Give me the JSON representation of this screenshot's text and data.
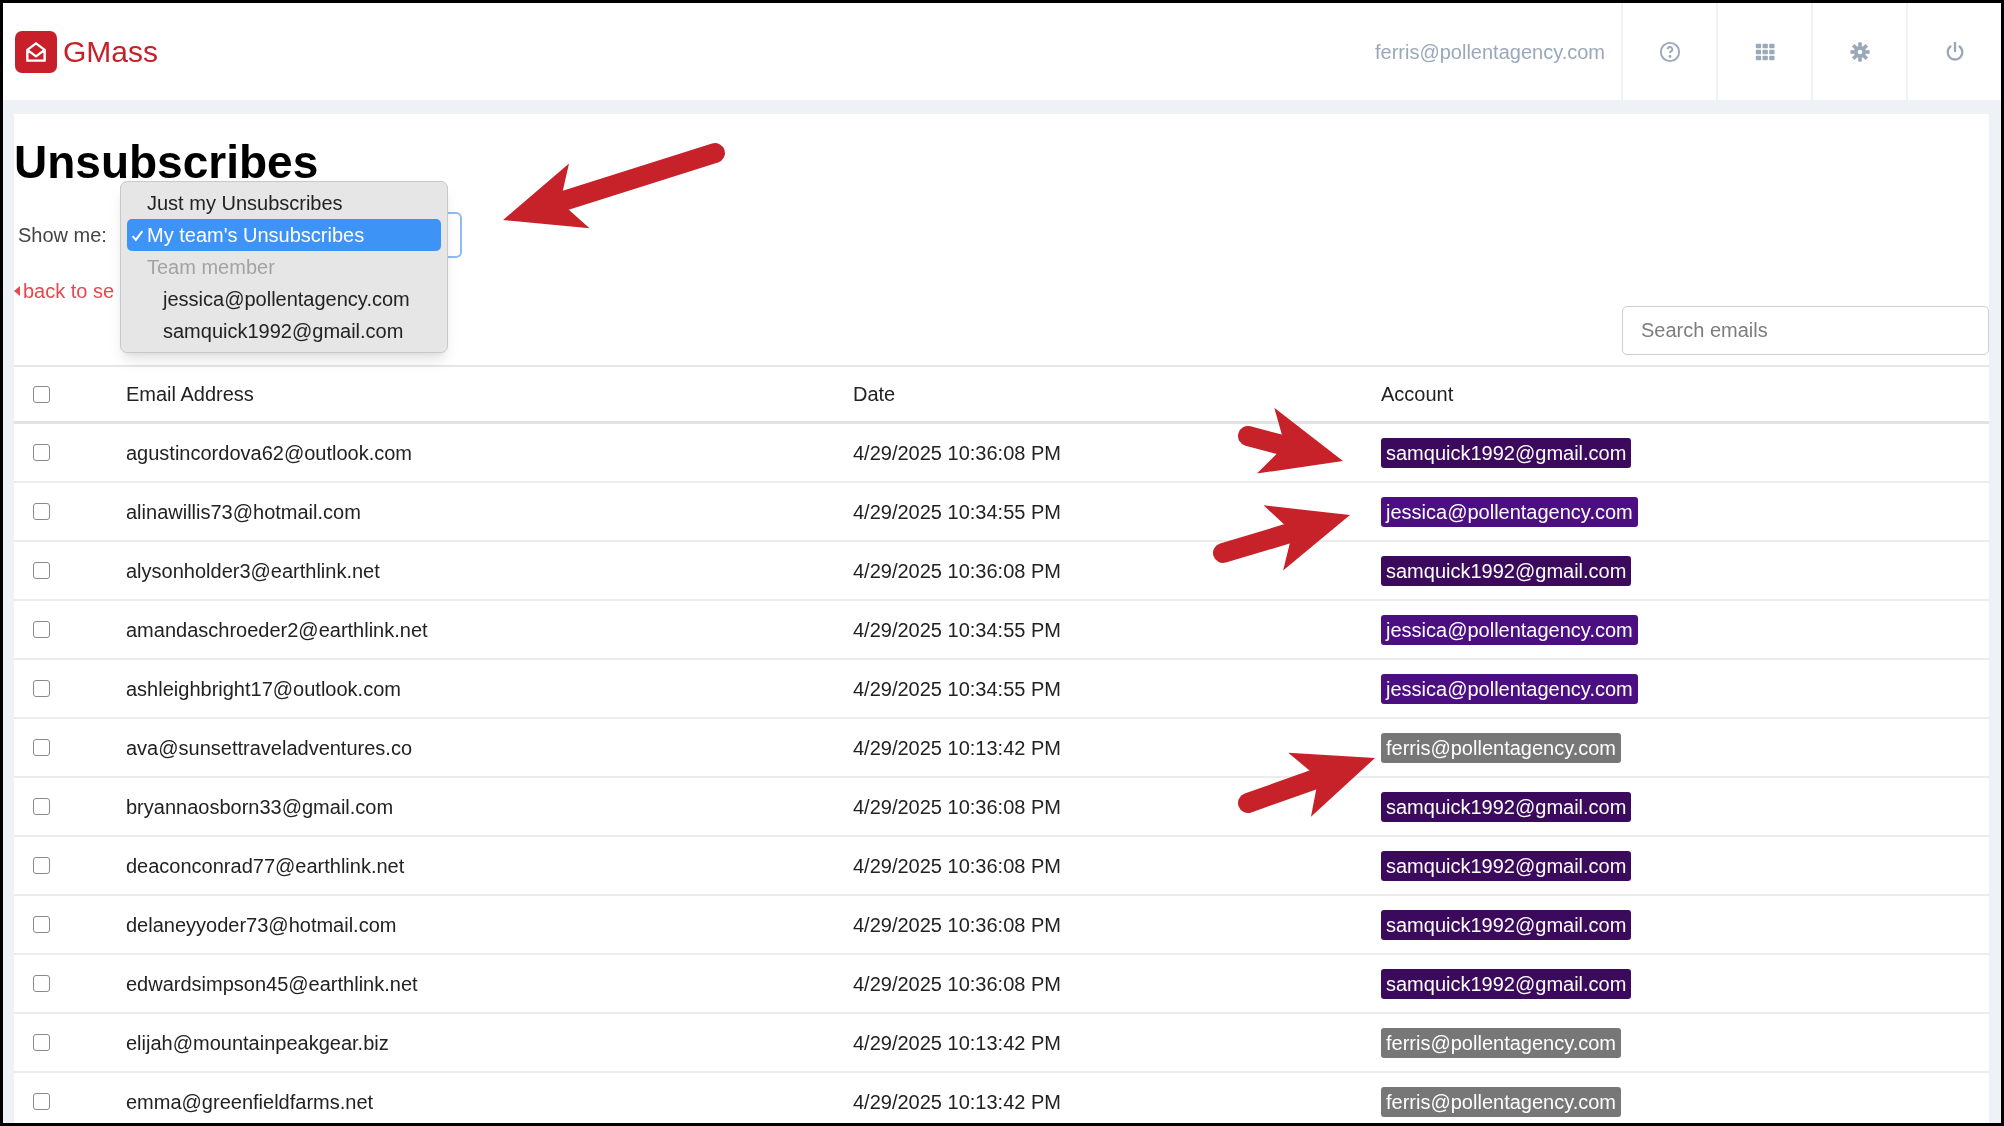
{
  "header": {
    "brand": "GMass",
    "user_email": "ferris@pollentagency.com"
  },
  "page_title": "Unsubscribes",
  "show_me": {
    "label": "Show me:",
    "options": [
      {
        "kind": "option",
        "label": "Just my Unsubscribes",
        "selected": false
      },
      {
        "kind": "option",
        "label": "My team's Unsubscribes",
        "selected": true
      },
      {
        "kind": "group",
        "label": "Team member",
        "children": [
          {
            "kind": "option",
            "label": "jessica@pollentagency.com",
            "selected": false
          },
          {
            "kind": "option",
            "label": "samquick1992@gmail.com",
            "selected": false
          }
        ]
      }
    ]
  },
  "back_link": "back to se",
  "search": {
    "placeholder": "Search emails"
  },
  "table": {
    "select_all_checked": false,
    "columns": [
      "Email Address",
      "Date",
      "Account"
    ],
    "rows": [
      {
        "checked": false,
        "email": "agustincordova62@outlook.com",
        "date": "4/29/2025 10:36:08 PM",
        "account": {
          "text": "samquick1992@gmail.com",
          "color": "#3b0a5c"
        }
      },
      {
        "checked": false,
        "email": "alinawillis73@hotmail.com",
        "date": "4/29/2025 10:34:55 PM",
        "account": {
          "text": "jessica@pollentagency.com",
          "color": "#4c0f82"
        }
      },
      {
        "checked": false,
        "email": "alysonholder3@earthlink.net",
        "date": "4/29/2025 10:36:08 PM",
        "account": {
          "text": "samquick1992@gmail.com",
          "color": "#3b0a5c"
        }
      },
      {
        "checked": false,
        "email": "amandaschroeder2@earthlink.net",
        "date": "4/29/2025 10:34:55 PM",
        "account": {
          "text": "jessica@pollentagency.com",
          "color": "#4c0f82"
        }
      },
      {
        "checked": false,
        "email": "ashleighbright17@outlook.com",
        "date": "4/29/2025 10:34:55 PM",
        "account": {
          "text": "jessica@pollentagency.com",
          "color": "#4c0f82"
        }
      },
      {
        "checked": false,
        "email": "ava@sunsettraveladventures.co",
        "date": "4/29/2025 10:13:42 PM",
        "account": {
          "text": "ferris@pollentagency.com",
          "color": "#777777"
        }
      },
      {
        "checked": false,
        "email": "bryannaosborn33@gmail.com",
        "date": "4/29/2025 10:36:08 PM",
        "account": {
          "text": "samquick1992@gmail.com",
          "color": "#3b0a5c"
        }
      },
      {
        "checked": false,
        "email": "deaconconrad77@earthlink.net",
        "date": "4/29/2025 10:36:08 PM",
        "account": {
          "text": "samquick1992@gmail.com",
          "color": "#3b0a5c"
        }
      },
      {
        "checked": false,
        "email": "delaneyyoder73@hotmail.com",
        "date": "4/29/2025 10:36:08 PM",
        "account": {
          "text": "samquick1992@gmail.com",
          "color": "#3b0a5c"
        }
      },
      {
        "checked": false,
        "email": "edwardsimpson45@earthlink.net",
        "date": "4/29/2025 10:36:08 PM",
        "account": {
          "text": "samquick1992@gmail.com",
          "color": "#3b0a5c"
        }
      },
      {
        "checked": false,
        "email": "elijah@mountainpeakgear.biz",
        "date": "4/29/2025 10:13:42 PM",
        "account": {
          "text": "ferris@pollentagency.com",
          "color": "#777777"
        }
      },
      {
        "checked": false,
        "email": "emma@greenfieldfarms.net",
        "date": "4/29/2025 10:13:42 PM",
        "account": {
          "text": "ferris@pollentagency.com",
          "color": "#777777"
        }
      }
    ]
  }
}
